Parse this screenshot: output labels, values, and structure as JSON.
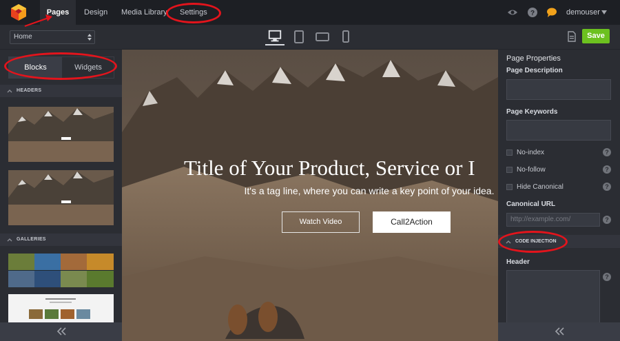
{
  "topbar": {
    "tabs": [
      {
        "label": "Pages",
        "active": true
      },
      {
        "label": "Design",
        "active": false
      },
      {
        "label": "Media Library",
        "active": false
      },
      {
        "label": "Settings",
        "active": false
      }
    ],
    "icons": [
      "eye-icon",
      "help-icon",
      "chat-icon"
    ],
    "user": "demouser"
  },
  "toolbar": {
    "page_select": "Home",
    "devices": [
      "desktop",
      "tablet",
      "tablet-landscape",
      "mobile"
    ],
    "active_device": "desktop",
    "save_label": "Save"
  },
  "left_panel": {
    "tabs": [
      "Blocks",
      "Widgets"
    ],
    "active_tab": "Blocks",
    "sections": [
      {
        "title": "HEADERS",
        "thumbs": 2
      },
      {
        "title": "GALLERIES",
        "thumbs": 2
      }
    ],
    "thumb_title": "Title of Your Product, Service or Idea"
  },
  "canvas": {
    "title": "Title of Your Product, Service or I",
    "tagline": "It's a tag line, where you can write a key point of your idea.",
    "secondary_button": "Watch Video",
    "primary_button": "Call2Action"
  },
  "right_panel": {
    "title": "Page Properties",
    "description_label": "Page Description",
    "keywords_label": "Page Keywords",
    "checkboxes": [
      "No-index",
      "No-follow",
      "Hide Canonical"
    ],
    "help_glyph": "?",
    "canonical_label": "Canonical URL",
    "canonical_placeholder": "http://example.com/",
    "code_injection_title": "CODE INJECTION",
    "header_label": "Header"
  },
  "colors": {
    "accent_green": "#6cc11f",
    "annotation_red": "#e3141c",
    "panel_bg": "#2b2d33",
    "topbar_bg": "#1d1f24"
  }
}
